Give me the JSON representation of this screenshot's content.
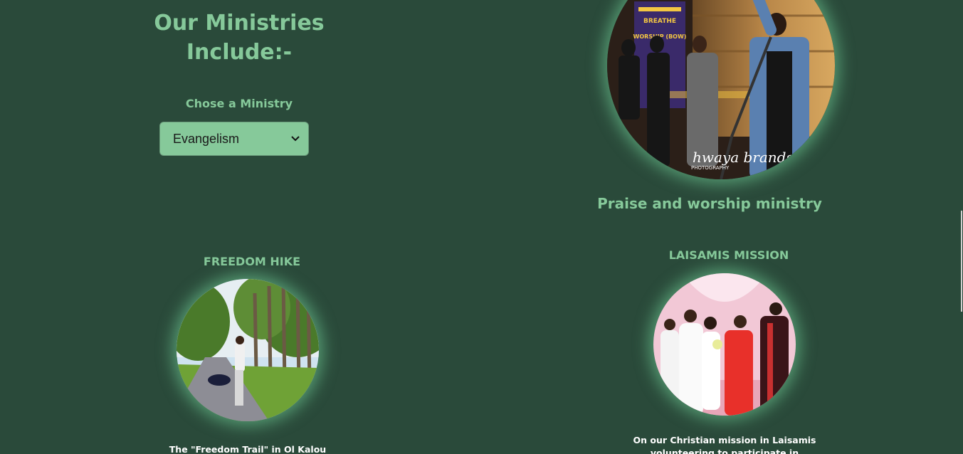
{
  "section": {
    "heading": "Our Ministries Include:-",
    "chose_label": "Chose a Ministry",
    "select_value": "Evangelism"
  },
  "ministries": {
    "worship": {
      "caption": "Praise and worship ministry"
    },
    "hike": {
      "title": "FREEDOM HIKE",
      "description": "The \"Freedom Trail\" in Ol Kalou offers a"
    },
    "mission": {
      "title": "LAISAMIS MISSION",
      "description": "On our Christian mission in Laisamis volunteering to participate in meaningful"
    }
  },
  "photo_text": {
    "banner": "BREATHE WORSHIP (BOW)",
    "watermark": "hwaya brands",
    "watermark_sub": "PHOTOGRAPHY"
  },
  "colors": {
    "background": "#2a4a3a",
    "accent": "#86c99a",
    "glow": "#78dca0"
  }
}
